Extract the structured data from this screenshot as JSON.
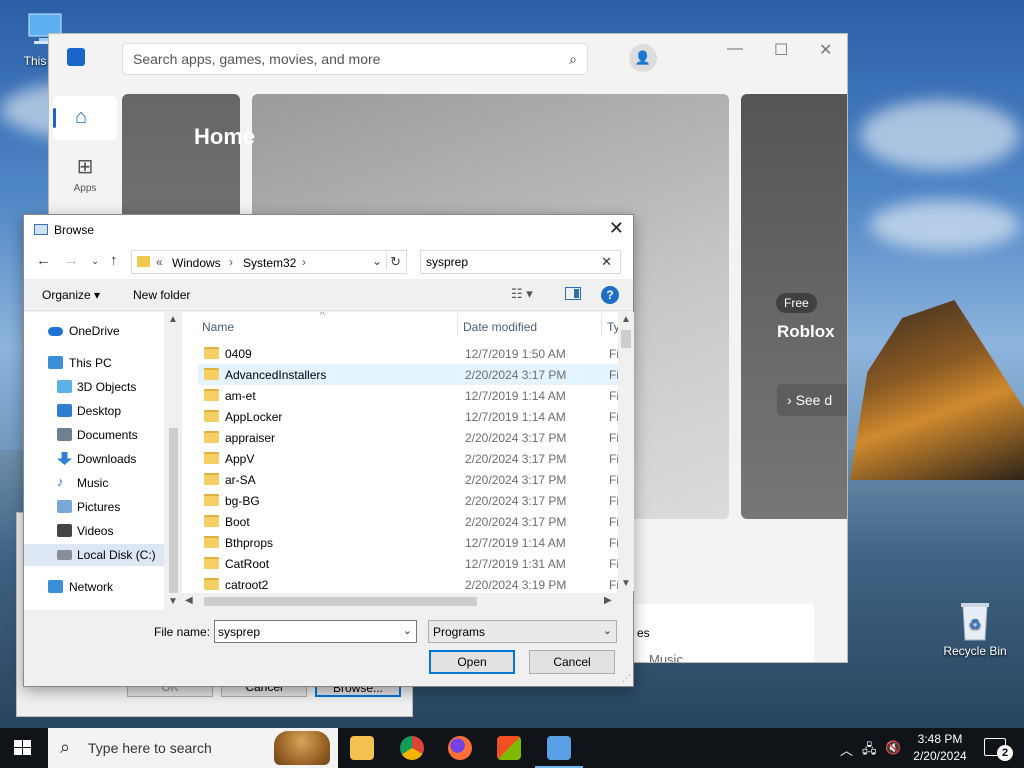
{
  "desktop": {
    "this_pc_label": "This PC",
    "recycle_bin_label": "Recycle Bin"
  },
  "store": {
    "search_placeholder": "Search apps, games, movies, and more",
    "nav_apps_label": "Apps",
    "home_title": "Home",
    "free_badge": "Free",
    "featured_title": "Roblox",
    "see_label": "See d",
    "card_title": "es",
    "card_subtitle": "Music"
  },
  "back_dialog": {
    "ok_label": "OK",
    "cancel_label": "Cancel",
    "browse_label": "Browse..."
  },
  "dialog": {
    "title": "Browse",
    "breadcrumb_prefix": "«",
    "breadcrumbs": [
      "Windows",
      "System32"
    ],
    "search_value": "sysprep",
    "organize_label": "Organize",
    "new_folder_label": "New folder",
    "columns": {
      "name": "Name",
      "date": "Date modified",
      "type": "Ty"
    },
    "tree": [
      {
        "label": "OneDrive",
        "icon": "cloud-icon",
        "color": "#1f74d4"
      },
      {
        "label": "This PC",
        "icon": "pc-icon",
        "color": "#3a8fd8"
      },
      {
        "label": "3D Objects",
        "icon": "cube-icon",
        "color": "#5bb2e8"
      },
      {
        "label": "Desktop",
        "icon": "desktop-icon",
        "color": "#2e7fd1"
      },
      {
        "label": "Documents",
        "icon": "documents-icon",
        "color": "#6f7f90"
      },
      {
        "label": "Downloads",
        "icon": "download-icon",
        "color": "#2f7ed8"
      },
      {
        "label": "Music",
        "icon": "music-icon",
        "color": "#2f7ed8"
      },
      {
        "label": "Pictures",
        "icon": "pictures-icon",
        "color": "#7aa7d6"
      },
      {
        "label": "Videos",
        "icon": "videos-icon",
        "color": "#444444"
      },
      {
        "label": "Local Disk (C:)",
        "icon": "disk-icon",
        "color": "#8a8f97"
      },
      {
        "label": "Network",
        "icon": "network-icon",
        "color": "#3a8fd8"
      }
    ],
    "files": [
      {
        "name": "0409",
        "date": "12/7/2019 1:50 AM",
        "type": "Fi"
      },
      {
        "name": "AdvancedInstallers",
        "date": "2/20/2024 3:17 PM",
        "type": "Fi"
      },
      {
        "name": "am-et",
        "date": "12/7/2019 1:14 AM",
        "type": "Fi"
      },
      {
        "name": "AppLocker",
        "date": "12/7/2019 1:14 AM",
        "type": "Fi"
      },
      {
        "name": "appraiser",
        "date": "2/20/2024 3:17 PM",
        "type": "Fi"
      },
      {
        "name": "AppV",
        "date": "2/20/2024 3:17 PM",
        "type": "Fi"
      },
      {
        "name": "ar-SA",
        "date": "2/20/2024 3:17 PM",
        "type": "Fi"
      },
      {
        "name": "bg-BG",
        "date": "2/20/2024 3:17 PM",
        "type": "Fi"
      },
      {
        "name": "Boot",
        "date": "2/20/2024 3:17 PM",
        "type": "Fi"
      },
      {
        "name": "Bthprops",
        "date": "12/7/2019 1:14 AM",
        "type": "Fi"
      },
      {
        "name": "CatRoot",
        "date": "12/7/2019 1:31 AM",
        "type": "Fi"
      },
      {
        "name": "catroot2",
        "date": "2/20/2024 3:19 PM",
        "type": "Fi"
      }
    ],
    "file_name_label": "File name:",
    "file_name_value": "sysprep",
    "file_type_value": "Programs",
    "open_label": "Open",
    "cancel_label": "Cancel"
  },
  "taskbar": {
    "search_placeholder": "Type here to search",
    "time": "3:48 PM",
    "date": "2/20/2024",
    "notification_count": "2"
  }
}
